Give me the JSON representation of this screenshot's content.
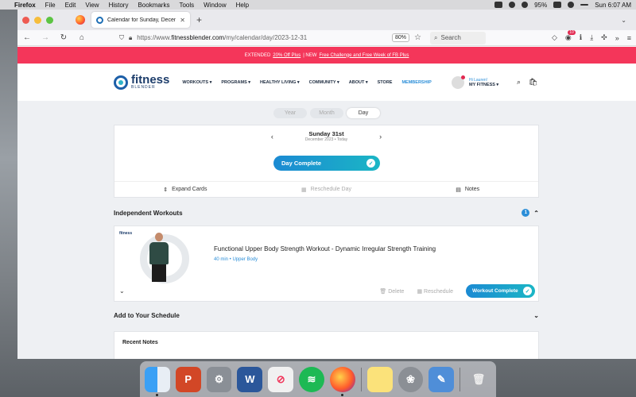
{
  "menubar": {
    "app": "Firefox",
    "items": [
      "File",
      "Edit",
      "View",
      "History",
      "Bookmarks",
      "Tools",
      "Window",
      "Help"
    ],
    "battery": "95%",
    "clock": "Sun 6:07 AM"
  },
  "browser": {
    "tab_title": "Calendar for Sunday, December",
    "url_prefix": "https://www.",
    "url_domain": "fitnessblender.com",
    "url_path": "/my/calendar/day/2023-12-31",
    "zoom": "80%",
    "search_placeholder": "Search",
    "notif_badge": "10"
  },
  "promo": {
    "prefix": "EXTENDED",
    "link1": "20% Off Plus",
    "middle": "| NEW",
    "link2": "Free Challenge and Free Week of FB Plus"
  },
  "site": {
    "logo_line1": "fitness",
    "logo_line2": "BLENDER",
    "nav": [
      "WORKOUTS ▾",
      "PROGRAMS ▾",
      "HEALTHY LIVING ▾",
      "COMMUNITY ▾",
      "ABOUT ▾",
      "STORE",
      "MEMBERSHIP"
    ],
    "greeting": "Hi Lauren!",
    "my_fitness": "MY FITNESS ▾"
  },
  "calendar": {
    "views": [
      "Year",
      "Month",
      "Day"
    ],
    "active_view": "Day",
    "day_title": "Sunday 31st",
    "day_subtitle": "December 2023 • Today",
    "day_complete_label": "Day Complete",
    "actions": [
      "Expand Cards",
      "Reschedule Day",
      "Notes"
    ]
  },
  "independent": {
    "heading": "Independent Workouts",
    "count": "1"
  },
  "workout": {
    "brand": "fitness",
    "title": "Functional Upper Body Strength Workout - Dynamic Irregular Strength Training",
    "meta": "40 min • Upper Body",
    "delete_label": "Delete",
    "reschedule_label": "Reschedule",
    "complete_label": "Workout Complete"
  },
  "schedule": {
    "heading": "Add to Your Schedule"
  },
  "notes": {
    "heading": "Recent Notes"
  },
  "colors": {
    "accent": "#2b8ed8",
    "promo": "#f4365a",
    "teal": "#1bb6c5"
  }
}
